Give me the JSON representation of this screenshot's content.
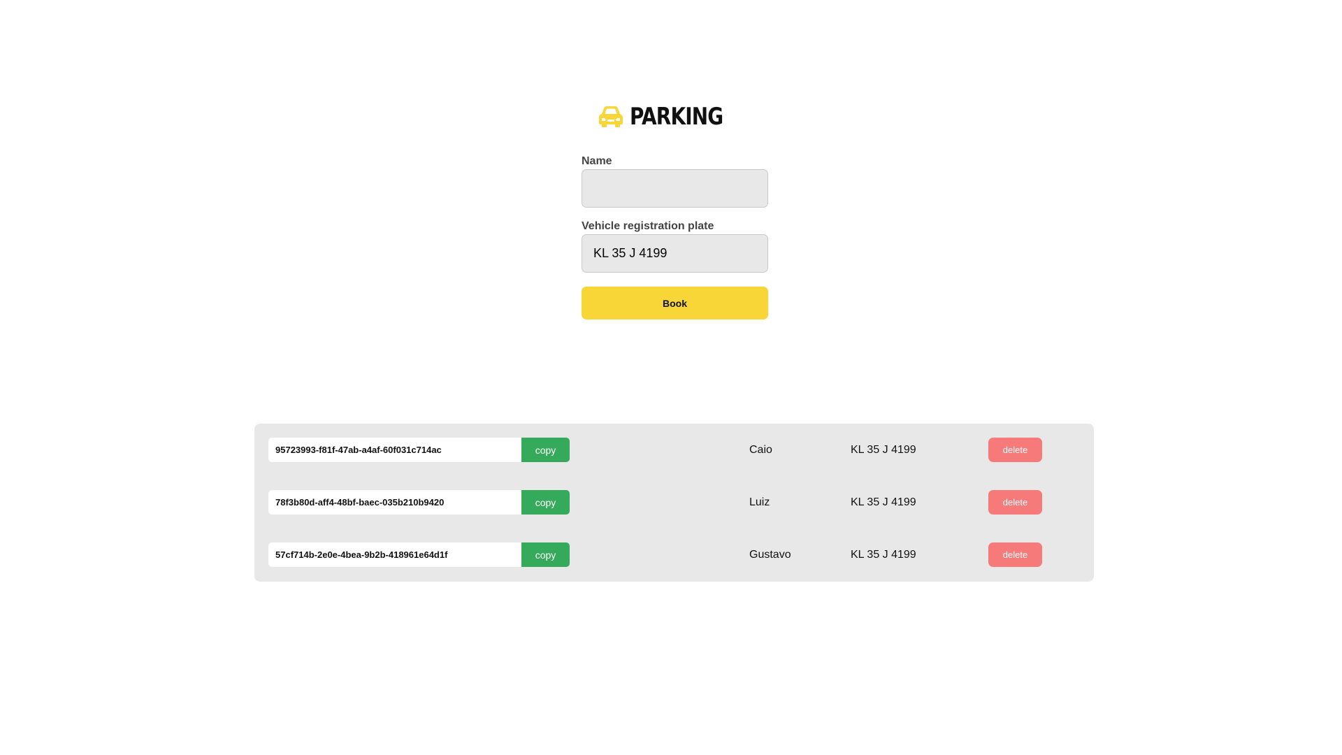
{
  "header": {
    "title": "PARKING",
    "icon": "car-icon",
    "icon_color": "#f8d638"
  },
  "form": {
    "name_label": "Name",
    "name_value": "",
    "plate_label": "Vehicle registration plate",
    "plate_value": "KL 35 J 4199",
    "book_label": "Book"
  },
  "colors": {
    "accent": "#f8d638",
    "copy": "#34aa5a",
    "delete": "#f77a7a",
    "panel": "#e8e8e8"
  },
  "bookings": [
    {
      "id": "95723993-f81f-47ab-a4af-60f031c714ac",
      "copy_label": "copy",
      "name": "Caio",
      "plate": "KL 35 J 4199",
      "delete_label": "delete"
    },
    {
      "id": "78f3b80d-aff4-48bf-baec-035b210b9420",
      "copy_label": "copy",
      "name": "Luiz",
      "plate": "KL 35 J 4199",
      "delete_label": "delete"
    },
    {
      "id": "57cf714b-2e0e-4bea-9b2b-418961e64d1f",
      "copy_label": "copy",
      "name": "Gustavo",
      "plate": "KL 35 J 4199",
      "delete_label": "delete"
    }
  ]
}
